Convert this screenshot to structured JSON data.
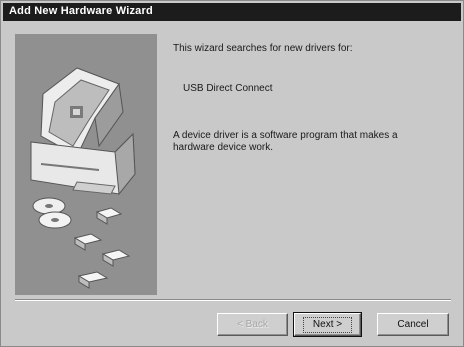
{
  "window": {
    "title": "Add New Hardware Wizard"
  },
  "content": {
    "intro": "This wizard searches for new drivers for:",
    "device_name": "USB Direct Connect",
    "description_line1": "A device driver is a software program that makes a",
    "description_line2": "hardware device work."
  },
  "buttons": {
    "back": "< Back",
    "next": "Next >",
    "cancel": "Cancel"
  },
  "colors": {
    "title_bar": "#1c1c1c",
    "dialog_bg": "#c9c9c9",
    "art_panel": "#909090"
  },
  "icons": [
    "computer-illustration",
    "disc-icon",
    "diskette-icon"
  ]
}
